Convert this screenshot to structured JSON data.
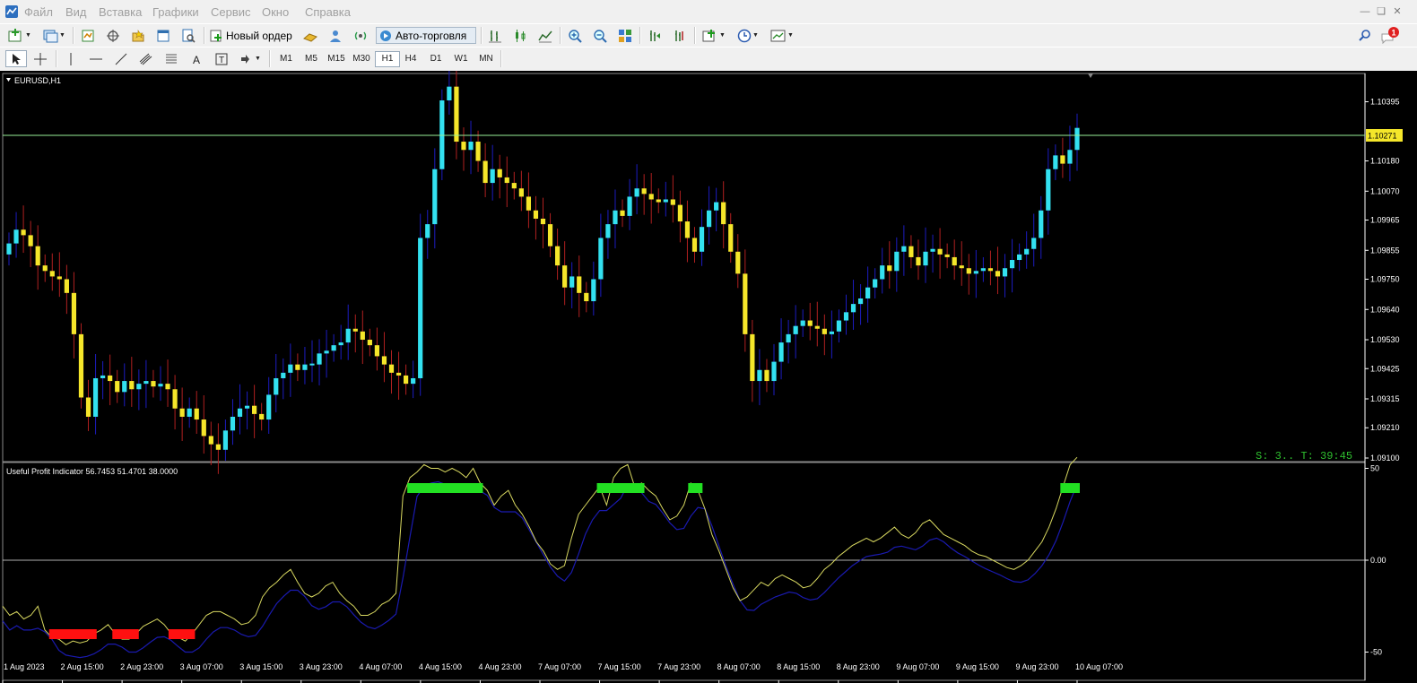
{
  "menu": [
    "Файл",
    "Вид",
    "Вставка",
    "Графики",
    "Сервис",
    "Окно",
    "Справка"
  ],
  "toolbar": {
    "new_order_label": "Новый ордер",
    "autotrade_label": "Авто-торговля",
    "timeframes": [
      "M1",
      "M5",
      "M15",
      "M30",
      "H1",
      "H4",
      "D1",
      "W1",
      "MN"
    ],
    "active_timeframe": "H1",
    "notification_count": "1"
  },
  "chart": {
    "symbol_label": "EURUSD,H1",
    "current_price_label": "1.10271",
    "timer_text": "S: 3.. T: 39:45",
    "price_axis_labels": [
      "1.10395",
      "1.10180",
      "1.10070",
      "1.09965",
      "1.09855",
      "1.09750",
      "1.09640",
      "1.09530",
      "1.09425",
      "1.09315",
      "1.09210",
      "1.09100"
    ],
    "indicator_label": "Useful Profit Indicator 56.7453 51.4701 38.0000",
    "indicator_axis_labels": [
      "50",
      "0.00",
      "-50"
    ],
    "time_axis_labels": [
      "1 Aug 2023",
      "2 Aug 15:00",
      "2 Aug 23:00",
      "3 Aug 07:00",
      "3 Aug 15:00",
      "3 Aug 23:00",
      "4 Aug 07:00",
      "4 Aug 15:00",
      "4 Aug 23:00",
      "7 Aug 07:00",
      "7 Aug 15:00",
      "7 Aug 23:00",
      "8 Aug 07:00",
      "8 Aug 15:00",
      "8 Aug 23:00",
      "9 Aug 07:00",
      "9 Aug 15:00",
      "9 Aug 23:00",
      "10 Aug 07:00"
    ],
    "colors": {
      "bull": "#33e1f0",
      "bear": "#f5e62a",
      "bull_wick": "#1c1cc0",
      "bear_wick": "#b02020",
      "price_line": "#98f098",
      "ind_fast": "#d8d860",
      "ind_slow": "#1a1ab0",
      "buy_signal": "#22e022",
      "sell_signal": "#ff1010"
    },
    "closes": [
      1.0988,
      1.0993,
      1.0991,
      1.0987,
      1.098,
      1.0978,
      1.0976,
      1.0975,
      1.097,
      1.0955,
      1.0932,
      1.0925,
      1.0939,
      1.094,
      1.0938,
      1.0934,
      1.0938,
      1.0935,
      1.0937,
      1.0938,
      1.0936,
      1.0937,
      1.0935,
      1.0928,
      1.0925,
      1.0928,
      1.0924,
      1.0918,
      1.0915,
      1.0913,
      1.092,
      1.0925,
      1.0928,
      1.0929,
      1.0926,
      1.0924,
      1.0933,
      1.0939,
      1.0941,
      1.0944,
      1.0942,
      1.0944,
      1.0944,
      1.0948,
      1.0949,
      1.0951,
      1.0952,
      1.0957,
      1.0956,
      1.0953,
      1.0951,
      1.0947,
      1.0944,
      1.0941,
      1.094,
      1.0937,
      1.0939,
      1.099,
      1.0995,
      1.1015,
      1.104,
      1.1045,
      1.1025,
      1.1022,
      1.1025,
      1.1018,
      1.101,
      1.1015,
      1.1012,
      1.101,
      1.1008,
      1.1005,
      1.1,
      1.0997,
      1.0995,
      1.0987,
      1.098,
      1.0972,
      1.0976,
      1.097,
      1.0967,
      1.0975,
      1.099,
      1.0995,
      1.1,
      1.0998,
      1.1005,
      1.1008,
      1.1006,
      1.1004,
      1.1003,
      1.1004,
      1.1002,
      1.0996,
      1.099,
      1.0985,
      1.0994,
      1.1,
      1.1003,
      1.0995,
      1.0985,
      1.0977,
      1.0955,
      1.0938,
      1.0942,
      1.0938,
      1.0945,
      1.0952,
      1.0955,
      1.0958,
      1.096,
      1.0958,
      1.0957,
      1.0955,
      1.0956,
      1.096,
      1.0963,
      1.0966,
      1.0968,
      1.0972,
      1.0975,
      1.098,
      1.0978,
      1.0985,
      1.0987,
      1.0983,
      1.098,
      1.0985,
      1.0986,
      1.0984,
      1.0983,
      1.098,
      1.0979,
      1.0977,
      1.0978,
      1.0979,
      1.0978,
      1.0976,
      1.0979,
      1.0982,
      1.0984,
      1.0986,
      1.099,
      1.1,
      1.1015,
      1.102,
      1.1017,
      1.1022,
      1.103
    ],
    "ind_fast": [
      -25,
      -30,
      -28,
      -32,
      -30,
      -25,
      -38,
      -42,
      -43,
      -46,
      -44,
      -45,
      -44,
      -40,
      -38,
      -35,
      -40,
      -43,
      -43,
      -40,
      -36,
      -34,
      -32,
      -35,
      -40,
      -42,
      -44,
      -40,
      -35,
      -30,
      -28,
      -28,
      -30,
      -32,
      -35,
      -34,
      -30,
      -20,
      -15,
      -12,
      -8,
      -5,
      -12,
      -18,
      -20,
      -18,
      -14,
      -12,
      -18,
      -22,
      -25,
      -30,
      -30,
      -28,
      -24,
      -22,
      -18,
      35,
      45,
      48,
      52,
      50,
      50,
      48,
      50,
      48,
      45,
      50,
      42,
      38,
      30,
      35,
      38,
      30,
      25,
      18,
      10,
      5,
      -2,
      -5,
      -3,
      12,
      25,
      30,
      35,
      40,
      30,
      45,
      50,
      52,
      40,
      42,
      38,
      35,
      28,
      22,
      24,
      30,
      42,
      38,
      28,
      14,
      5,
      -5,
      -15,
      -22,
      -20,
      -16,
      -12,
      -14,
      -10,
      -8,
      -10,
      -12,
      -15,
      -14,
      -10,
      -5,
      -2,
      2,
      5,
      8,
      10,
      12,
      10,
      12,
      15,
      18,
      14,
      12,
      15,
      20,
      22,
      18,
      14,
      12,
      10,
      8,
      5,
      3,
      2,
      0,
      -2,
      -4,
      -5,
      -3,
      0,
      5,
      10,
      18,
      28,
      40,
      52,
      56
    ]
  }
}
